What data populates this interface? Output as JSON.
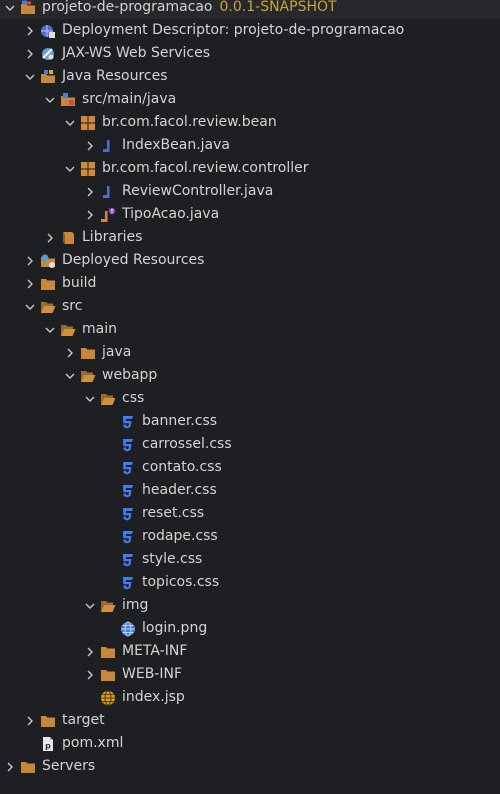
{
  "project": {
    "name": "projeto-de-programacao",
    "version": "0.0.1-SNAPSHOT"
  },
  "tree": {
    "deployment_descriptor": "Deployment Descriptor: projeto-de-programacao",
    "jaxws": "JAX-WS Web Services",
    "java_resources": "Java Resources",
    "src_main_java": "src/main/java",
    "pkg_bean": "br.com.facol.review.bean",
    "index_bean": "IndexBean.java",
    "pkg_controller": "br.com.facol.review.controller",
    "review_controller": "ReviewController.java",
    "tipo_acao": "TipoAcao.java",
    "libraries": "Libraries",
    "deployed_resources": "Deployed Resources",
    "build": "build",
    "src": "src",
    "main": "main",
    "java": "java",
    "webapp": "webapp",
    "css": "css",
    "css_files": [
      "banner.css",
      "carrossel.css",
      "contato.css",
      "header.css",
      "reset.css",
      "rodape.css",
      "style.css",
      "topicos.css"
    ],
    "img": "img",
    "login_png": "login.png",
    "meta_inf": "META-INF",
    "web_inf": "WEB-INF",
    "index_jsp": "index.jsp",
    "target": "target",
    "pom_xml": "pom.xml",
    "servers": "Servers"
  },
  "colors": {
    "background": "#1e1f22",
    "text": "#d4d4d4",
    "version": "#c9a43a",
    "folder": "#c8883a",
    "css_icon": "#3f7ef0"
  }
}
